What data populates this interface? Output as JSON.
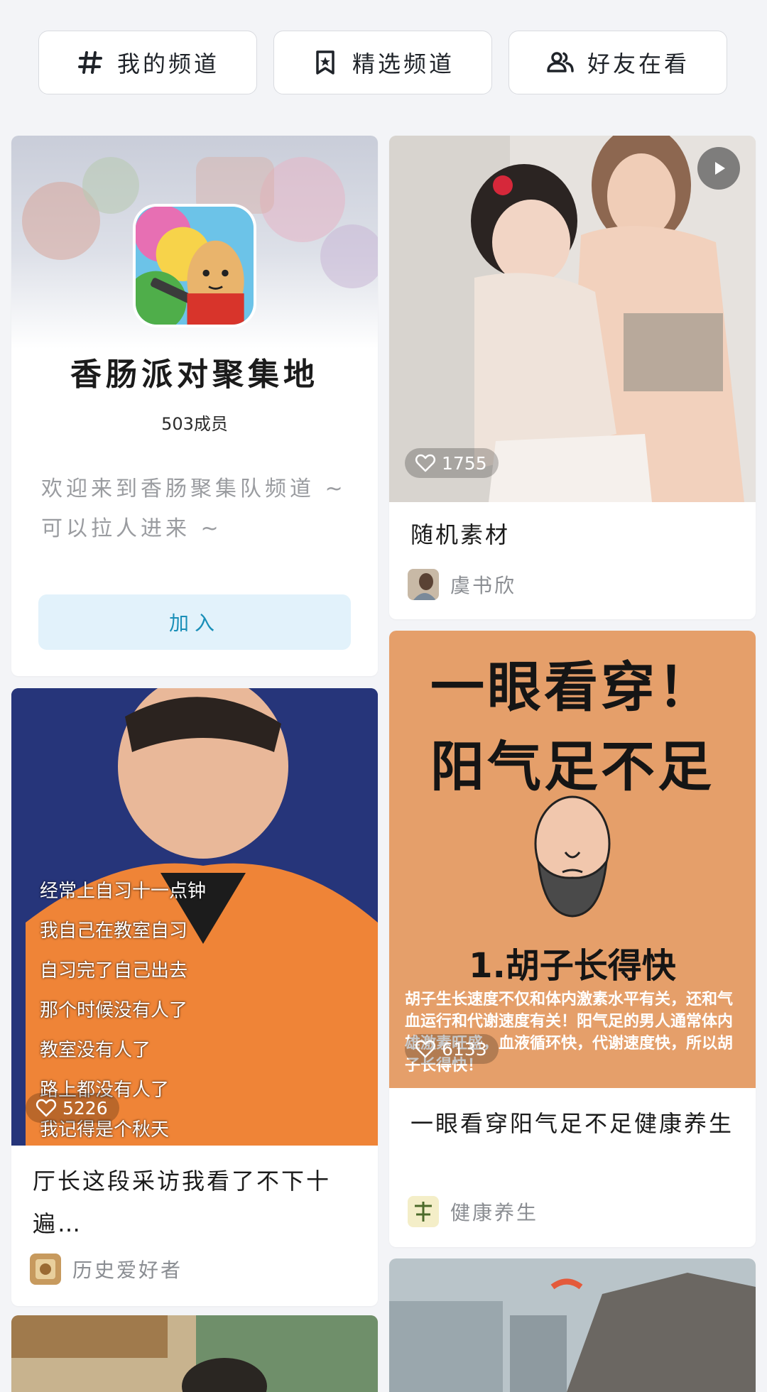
{
  "tabs": [
    {
      "label": "我的频道",
      "icon": "hash-icon"
    },
    {
      "label": "精选频道",
      "icon": "bookmark-star-icon"
    },
    {
      "label": "好友在看",
      "icon": "friends-icon"
    }
  ],
  "channel_card": {
    "name": "香肠派对聚集地",
    "members": "503成员",
    "description": "欢迎来到香肠聚集队频道 ~ 可以拉人进来 ~",
    "join_label": "加入"
  },
  "posts": [
    {
      "title": "随机素材",
      "likes": "1755",
      "author": "虞书欣",
      "has_play": true
    },
    {
      "title": "一眼看穿阳气足不足健康养生",
      "likes": "6133",
      "author": "健康养生",
      "image_text": {
        "headline1": "一眼看穿！",
        "headline2": "阳气足不足",
        "point": "1.胡子长得快",
        "body": "胡子生长速度不仅和体内激素水平有关，还和气血运行和代谢速度有关！阳气足的男人通常体内雄激素旺盛，血液循环快，代谢速度快，所以胡子长得快！"
      }
    },
    {
      "title": "厅长这段采访我看了不下十遍…",
      "likes": "5226",
      "author": "历史爱好者",
      "subtitles": [
        "经常上自习十一点钟",
        "我自己在教室自习",
        "自习完了自己出去",
        "那个时候没有人了",
        "教室没有人了",
        "路上都没有人了",
        "我记得是个秋天"
      ]
    }
  ],
  "colors": {
    "accent": "#1a8fb8",
    "join_bg": "#e2f2fb",
    "poster_bg": "#e59f6a"
  }
}
